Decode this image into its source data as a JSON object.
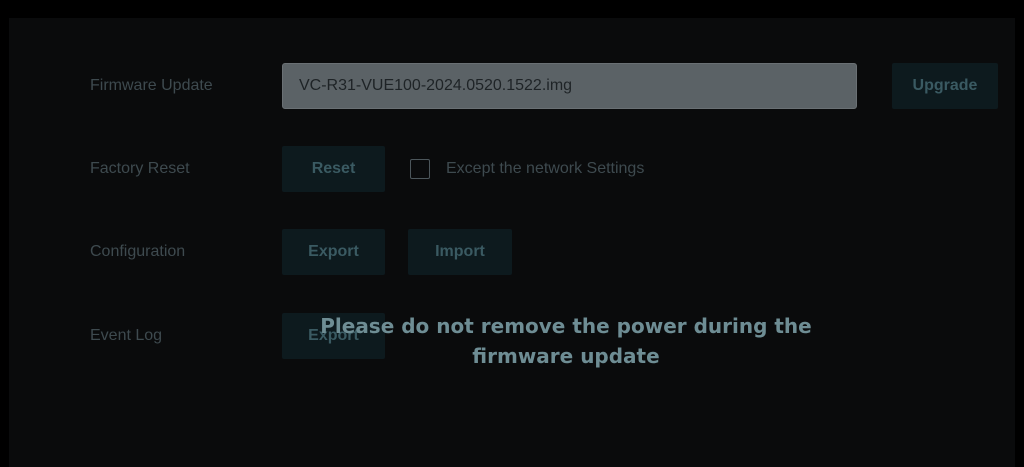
{
  "firmware_update": {
    "label": "Firmware Update",
    "file_value": "VC-R31-VUE100-2024.0520.1522.img",
    "upgrade_label": "Upgrade"
  },
  "factory_reset": {
    "label": "Factory Reset",
    "reset_label": "Reset",
    "except_network_label": "Except the network Settings",
    "except_network_checked": false
  },
  "configuration": {
    "label": "Configuration",
    "export_label": "Export",
    "import_label": "Import"
  },
  "event_log": {
    "label": "Event Log",
    "export_label": "Export"
  },
  "overlay": {
    "line1": "Please do not remove the power during the",
    "line2": "firmware update"
  },
  "colors": {
    "background": "#000000",
    "button_bg": "#0d1a1e",
    "button_text": "#3a5a62",
    "label_text": "#3e4a4f",
    "field_bg": "#5b6266",
    "overlay_text": "#6e8d94"
  }
}
